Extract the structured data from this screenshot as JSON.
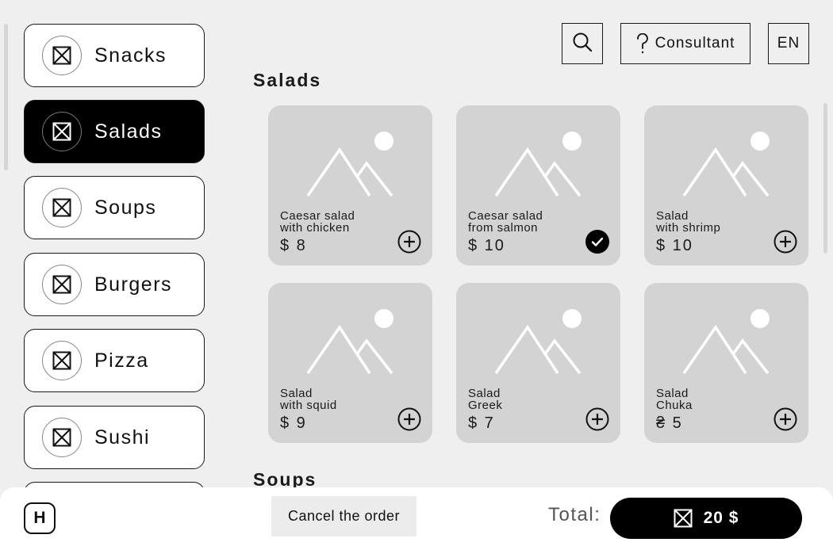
{
  "sidebar": {
    "items": [
      {
        "label": "Snacks",
        "icon": "placeholder-icon",
        "active": false
      },
      {
        "label": "Salads",
        "icon": "placeholder-icon",
        "active": true
      },
      {
        "label": "Soups",
        "icon": "placeholder-icon",
        "active": false
      },
      {
        "label": "Burgers",
        "icon": "placeholder-icon",
        "active": false
      },
      {
        "label": "Pizza",
        "icon": "placeholder-icon",
        "active": false
      },
      {
        "label": "Sushi",
        "icon": "placeholder-icon",
        "active": false
      }
    ]
  },
  "header": {
    "search_icon": "search-icon",
    "consultant_label": "Consultant",
    "consultant_icon": "question-icon",
    "language": "EN"
  },
  "sections": [
    {
      "title": "Salads",
      "products": [
        {
          "name_line1": "Caesar salad",
          "name_line2": "with chicken",
          "price": "$ 8",
          "state": "add"
        },
        {
          "name_line1": "Caesar salad",
          "name_line2": "from salmon",
          "price": "$ 10",
          "state": "added"
        },
        {
          "name_line1": "Salad",
          "name_line2": "with shrimp",
          "price": "$ 10",
          "state": "add"
        },
        {
          "name_line1": "Salad",
          "name_line2": "with squid",
          "price": "$ 9",
          "state": "add"
        },
        {
          "name_line1": "Salad",
          "name_line2": "Greek",
          "price": "$ 7",
          "state": "add"
        },
        {
          "name_line1": "Salad",
          "name_line2": "Chuka",
          "price": "₴ 5",
          "state": "add"
        }
      ]
    },
    {
      "title": "Soups"
    }
  ],
  "footer": {
    "logo": "H",
    "cancel_label": "Cancel the order",
    "total_label": "Total:",
    "total_amount": "20 $"
  },
  "colors": {
    "background": "#efefef",
    "card": "#d3d3d3",
    "accent": "#000000",
    "white": "#ffffff"
  }
}
